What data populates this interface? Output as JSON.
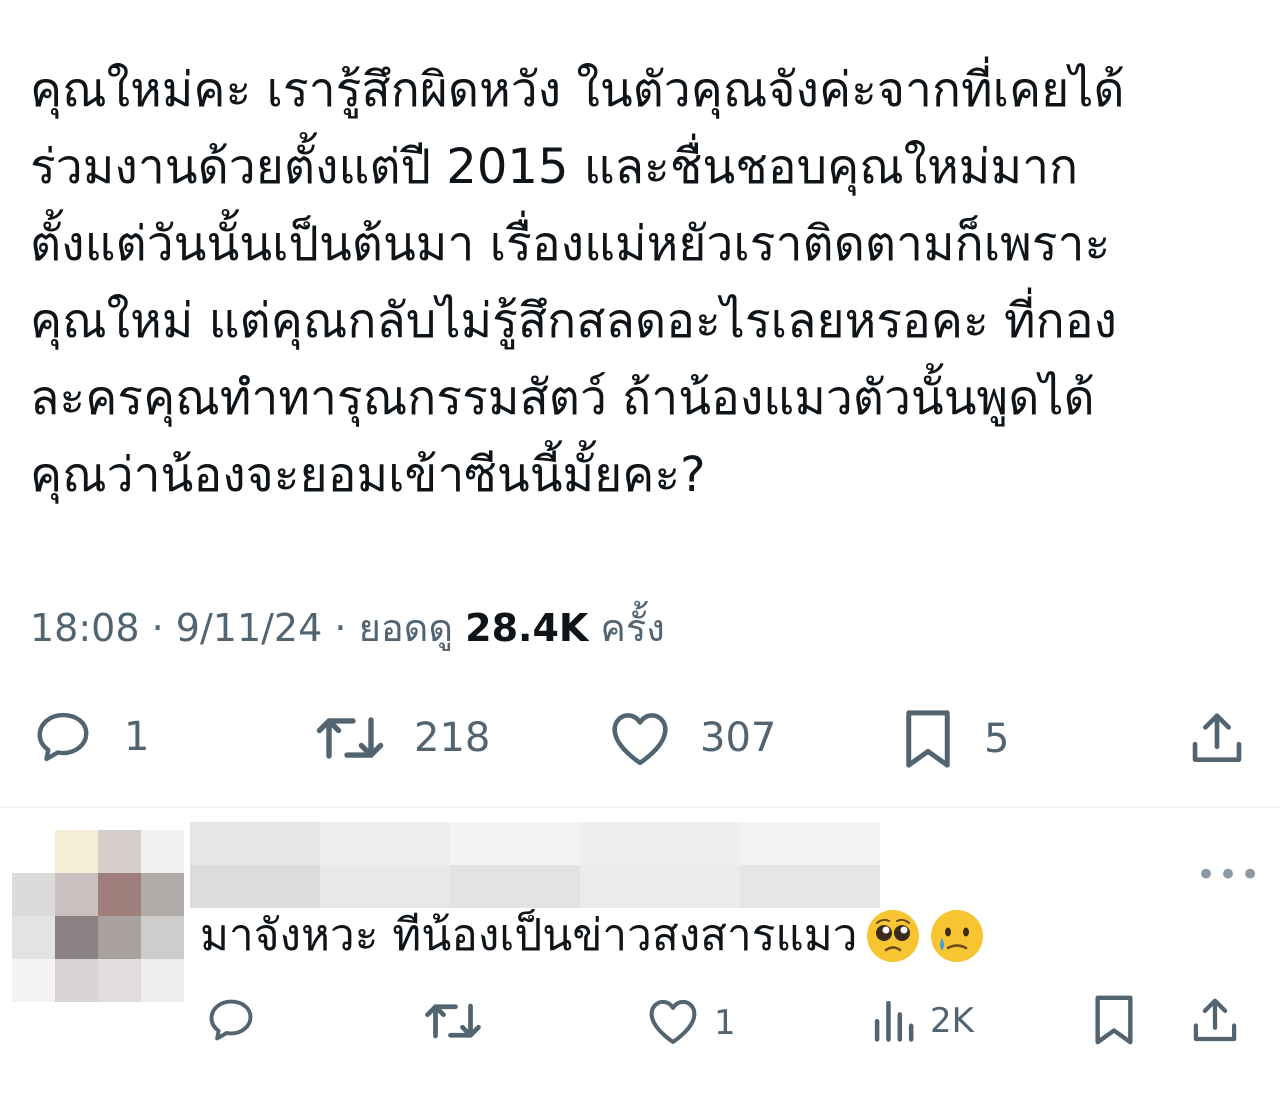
{
  "tweet": {
    "lines": [
      "คุณใหม่คะ เรารู้สึกผิดหวัง ในตัวคุณจังค่ะจากที่เคยได้",
      "ร่วมงานด้วยตั้งแต่ปี 2015 และชื่นชอบคุณใหม่มาก",
      "ตั้งแต่วันนั้นเป็นต้นมา เรื่องแม่หยัวเราติดตามก็เพราะ",
      "คุณใหม่ แต่คุณกลับไม่รู้สึกสลดอะไรเลยหรอคะ ที่กอง",
      "ละครคุณทำทารุณกรรมสัตว์ ถ้าน้องแมวตัวนั้นพูดได้",
      "คุณว่าน้องจะยอมเข้าซีนนี้มั้ยคะ?"
    ],
    "time": "18:08",
    "date": "9/11/24",
    "views_label": "ยอดดู",
    "views": "28.4K",
    "views_suffix": "ครั้ง",
    "separator": "·",
    "reply_count": "1",
    "retweet_count": "218",
    "like_count": "307",
    "bookmark_count": "5"
  },
  "reply": {
    "text": "มาจังหวะ ทีน้องเป็นข่าวสงสารแมว",
    "emojis": [
      "pleading-face-icon",
      "crying-face-icon"
    ],
    "more_label": "•••",
    "like_count": "1",
    "views_count": "2K"
  },
  "colors": {
    "text": "#0f1419",
    "secondary": "#536471",
    "divider": "#eff3f4",
    "emoji_face": "#f7c531"
  }
}
